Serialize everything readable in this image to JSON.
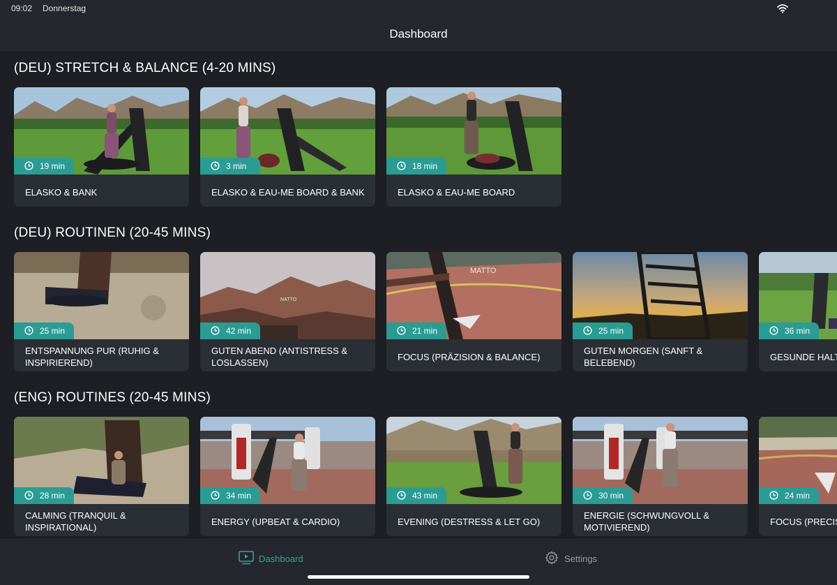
{
  "status": {
    "time": "09:02",
    "day": "Donnerstag"
  },
  "header": {
    "title": "Dashboard"
  },
  "sections": [
    {
      "title": "(DEU) STRETCH & BALANCE (4-20 MINS)",
      "cards": [
        {
          "duration": "19 min",
          "title": "ELASKO & BANK"
        },
        {
          "duration": "3 min",
          "title": "ELASKO & EAU-ME BOARD & BANK"
        },
        {
          "duration": "18 min",
          "title": "ELASKO & EAU-ME BOARD"
        }
      ]
    },
    {
      "title": "(DEU) ROUTINEN (20-45 MINS)",
      "cards": [
        {
          "duration": "25 min",
          "title": "ENTSPANNUNG PUR (RUHIG & INSPIRIEREND)"
        },
        {
          "duration": "42 min",
          "title": "GUTEN ABEND (ANTISTRESS & LOSLASSEN)"
        },
        {
          "duration": "21 min",
          "title": "FOCUS (PRÄZISION & BALANCE)"
        },
        {
          "duration": "25 min",
          "title": "GUTEN MORGEN (SANFT & BELEBEND)"
        },
        {
          "duration": "36 min",
          "title": "GESUNDE HALTUNG ÜBUNG"
        }
      ]
    },
    {
      "title": "(ENG) ROUTINES (20-45 MINS)",
      "cards": [
        {
          "duration": "28 min",
          "title": "CALMING (TRANQUIL & INSPIRATIONAL)"
        },
        {
          "duration": "34 min",
          "title": "ENERGY (UPBEAT & CARDIO)"
        },
        {
          "duration": "43 min",
          "title": "EVENING (DESTRESS & LET GO)"
        },
        {
          "duration": "30 min",
          "title": "ENERGIE (SCHWUNGVOLL & MOTIVIEREND)"
        },
        {
          "duration": "24 min",
          "title": "FOCUS (PRECISION & BALANCE)"
        }
      ]
    }
  ],
  "tabbar": {
    "dashboard_label": "Dashboard",
    "settings_label": "Settings"
  },
  "icons": {
    "wifi": "wifi-icon",
    "clock": "clock-icon",
    "dashboard": "monitor-play-icon",
    "settings": "gear-icon"
  },
  "colors": {
    "accent": "#2a9c93",
    "background": "#1d1f24",
    "card": "#2a2e35"
  }
}
